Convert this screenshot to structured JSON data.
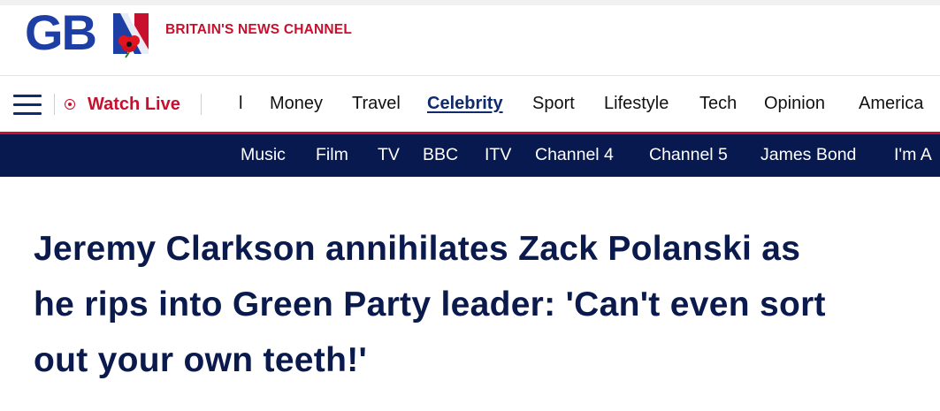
{
  "brand": {
    "logo_text": "GB",
    "tagline": "BRITAIN'S NEWS CHANNEL",
    "blue": "#1d3fa5",
    "red": "#c8102e",
    "navy": "#07194f"
  },
  "main_nav": {
    "menu_icon": "hamburger-icon",
    "watch_live": "Watch Live",
    "watch_icon": "live-record-icon",
    "partial_item": "l",
    "items": [
      "Money",
      "Travel",
      "Celebrity",
      "Sport",
      "Lifestyle",
      "Tech",
      "Opinion",
      "America"
    ],
    "active": "Celebrity"
  },
  "sub_nav": {
    "items": [
      "Music",
      "Film",
      "TV",
      "BBC",
      "ITV",
      "Channel 4",
      "Channel 5",
      "James Bond",
      "I'm A"
    ]
  },
  "article": {
    "headline_lines": [
      "Jeremy Clarkson annihilates Zack Polanski as",
      "he rips into Green Party leader: 'Can't even sort",
      "out your own teeth!'"
    ]
  }
}
